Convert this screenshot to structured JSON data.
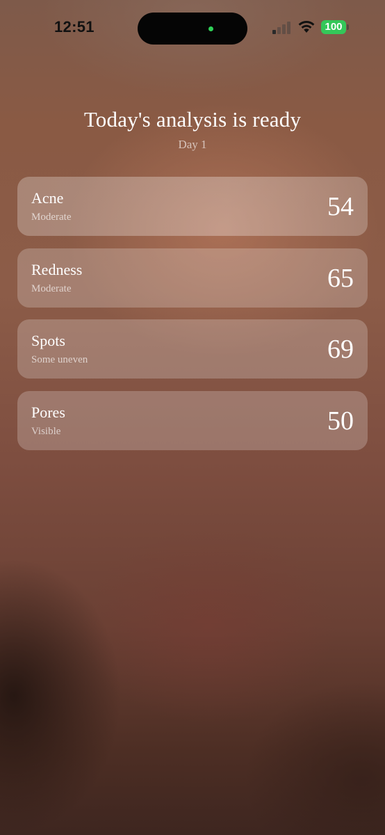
{
  "status_bar": {
    "time": "12:51",
    "battery": "100"
  },
  "header": {
    "title": "Today's analysis is ready",
    "subtitle": "Day 1"
  },
  "metrics": [
    {
      "label": "Acne",
      "description": "Moderate",
      "score": "54"
    },
    {
      "label": "Redness",
      "description": "Moderate",
      "score": "65"
    },
    {
      "label": "Spots",
      "description": "Some uneven",
      "score": "69"
    },
    {
      "label": "Pores",
      "description": "Visible",
      "score": "50"
    }
  ],
  "colors": {
    "battery_green": "#34c759",
    "camera_indicator": "#2fd158"
  },
  "icons": [
    "signal-icon",
    "wifi-icon",
    "battery-icon"
  ]
}
